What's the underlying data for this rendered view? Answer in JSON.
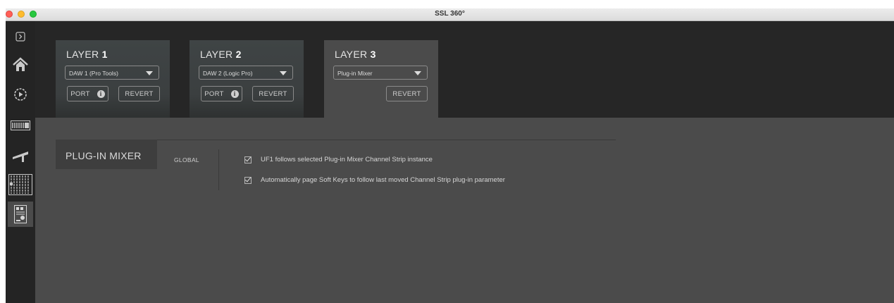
{
  "window": {
    "title": "SSL 360°"
  },
  "sidebar": {
    "items": [
      {
        "name": "expand-icon"
      },
      {
        "name": "home-icon"
      },
      {
        "name": "play-icon"
      },
      {
        "name": "console-icon"
      },
      {
        "name": "fader-icon"
      },
      {
        "name": "channel-strip-icon"
      },
      {
        "name": "uf1-icon",
        "active": true
      }
    ]
  },
  "layers": [
    {
      "label": "LAYER",
      "number": "1",
      "daw": "DAW 1 (Pro Tools)",
      "port": "PORT",
      "revert": "REVERT",
      "active": false
    },
    {
      "label": "LAYER",
      "number": "2",
      "daw": "DAW 2 (Logic Pro)",
      "port": "PORT",
      "revert": "REVERT",
      "active": false
    },
    {
      "label": "LAYER",
      "number": "3",
      "daw": "Plug-in Mixer",
      "revert": "REVERT",
      "active": true
    }
  ],
  "plugin_mixer": {
    "title": "PLUG-IN MIXER",
    "section": "GLOBAL",
    "options": [
      {
        "label": "UF1 follows selected Plug-in Mixer Channel Strip instance",
        "checked": true
      },
      {
        "label": "Automatically page Soft Keys to follow last moved Channel Strip plug-in parameter",
        "checked": true
      }
    ]
  },
  "colors": {
    "background": "#4b4b4b",
    "sidebar": "#242424",
    "topband": "#262626"
  }
}
